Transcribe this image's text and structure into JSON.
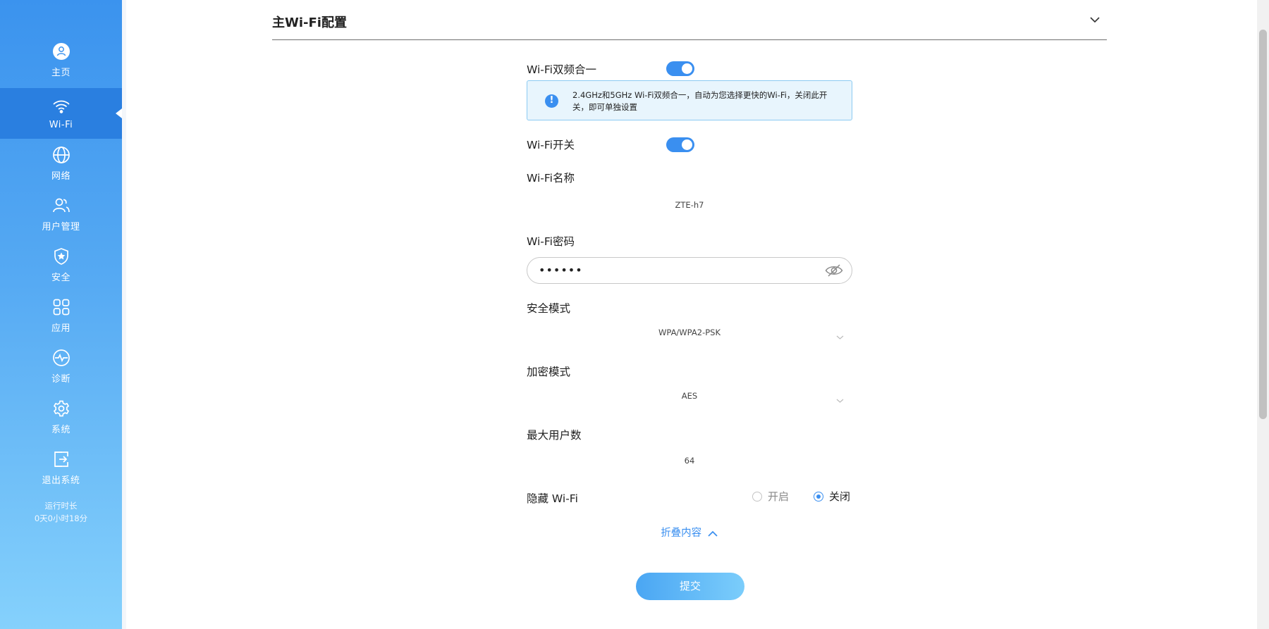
{
  "sidebar": {
    "items": [
      {
        "label": "主页",
        "icon": "home-icon"
      },
      {
        "label": "Wi-Fi",
        "icon": "wifi-icon",
        "active": true
      },
      {
        "label": "网络",
        "icon": "globe-icon"
      },
      {
        "label": "用户管理",
        "icon": "users-icon"
      },
      {
        "label": "安全",
        "icon": "shield-icon"
      },
      {
        "label": "应用",
        "icon": "apps-icon"
      },
      {
        "label": "诊断",
        "icon": "diagnostics-icon"
      },
      {
        "label": "系统",
        "icon": "gear-icon"
      },
      {
        "label": "退出系统",
        "icon": "logout-icon"
      }
    ],
    "uptime_label": "运行时长",
    "uptime_value": "0天0小时18分"
  },
  "section": {
    "title": "主Wi-Fi配置"
  },
  "form": {
    "dual_band_label": "Wi-Fi双频合一",
    "dual_band_on": true,
    "info_text": "2.4GHz和5GHz Wi-Fi双频合一，自动为您选择更快的Wi-Fi，关闭此开关，即可单独设置",
    "wifi_switch_label": "Wi-Fi开关",
    "wifi_switch_on": true,
    "ssid_label": "Wi-Fi名称",
    "ssid_value": "ZTE-h7",
    "password_label": "Wi-Fi密码",
    "password_value": "••••••",
    "security_mode_label": "安全模式",
    "security_mode_value": "WPA/WPA2-PSK",
    "encryption_mode_label": "加密模式",
    "encryption_mode_value": "AES",
    "max_users_label": "最大用户数",
    "max_users_value": "64",
    "hide_wifi_label": "隐藏 Wi-Fi",
    "hide_wifi_option_on": "开启",
    "hide_wifi_option_off": "关闭",
    "hide_wifi_selected": "关闭",
    "fold_label": "折叠内容",
    "submit_label": "提交"
  },
  "colors": {
    "accent": "#3a8ff0",
    "sidebar_top": "#3b93ee",
    "sidebar_bottom": "#85d1fc",
    "info_bg": "#e8f5fd"
  }
}
